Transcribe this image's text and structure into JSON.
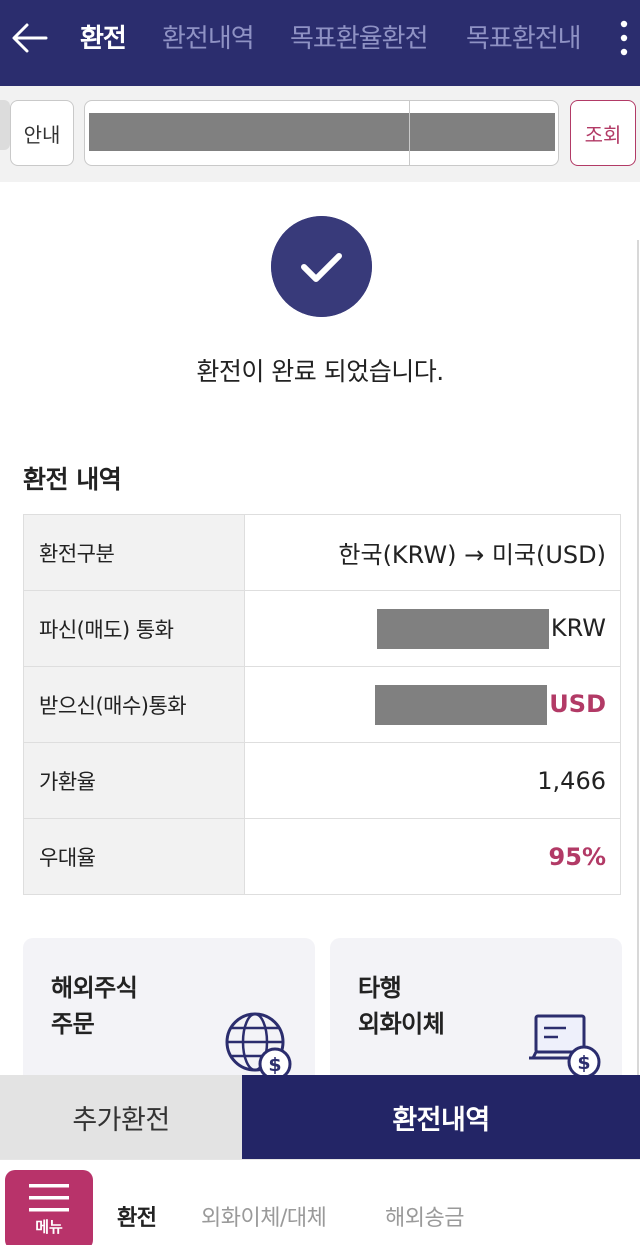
{
  "header": {
    "tabs": [
      {
        "label": "환전"
      },
      {
        "label": "환전내역"
      },
      {
        "label": "목표환율환전"
      },
      {
        "label": "목표환전내"
      }
    ]
  },
  "search": {
    "guide_label": "안내",
    "query_label": "조회"
  },
  "result": {
    "message": "환전이 완료 되었습니다."
  },
  "details": {
    "title": "환전 내역",
    "rows": [
      {
        "label": "환전구분",
        "value": "한국(KRW) → 미국(USD)"
      },
      {
        "label": "파신(매도) 통화",
        "value": "KRW"
      },
      {
        "label": "받으신(매수)통화",
        "value": "USD"
      },
      {
        "label": "가환율",
        "value": "1,466"
      },
      {
        "label": "우대율",
        "value": "95%"
      }
    ]
  },
  "cards": [
    {
      "line1": "해외주식",
      "line2": "주문",
      "icon": "globe-dollar-icon"
    },
    {
      "line1": "타행",
      "line2": "외화이체",
      "icon": "laptop-dollar-icon"
    }
  ],
  "actions": {
    "more_label": "추가환전",
    "history_label": "환전내역"
  },
  "bottom_nav": {
    "menu_label": "메뉴",
    "items": [
      {
        "label": "환전"
      },
      {
        "label": "외화이체/대체"
      },
      {
        "label": "해외송금"
      }
    ]
  },
  "colors": {
    "header": "#2b2d6e",
    "primary_button": "#232566",
    "accent": "#b23a66",
    "menu_button": "#b8336a"
  }
}
